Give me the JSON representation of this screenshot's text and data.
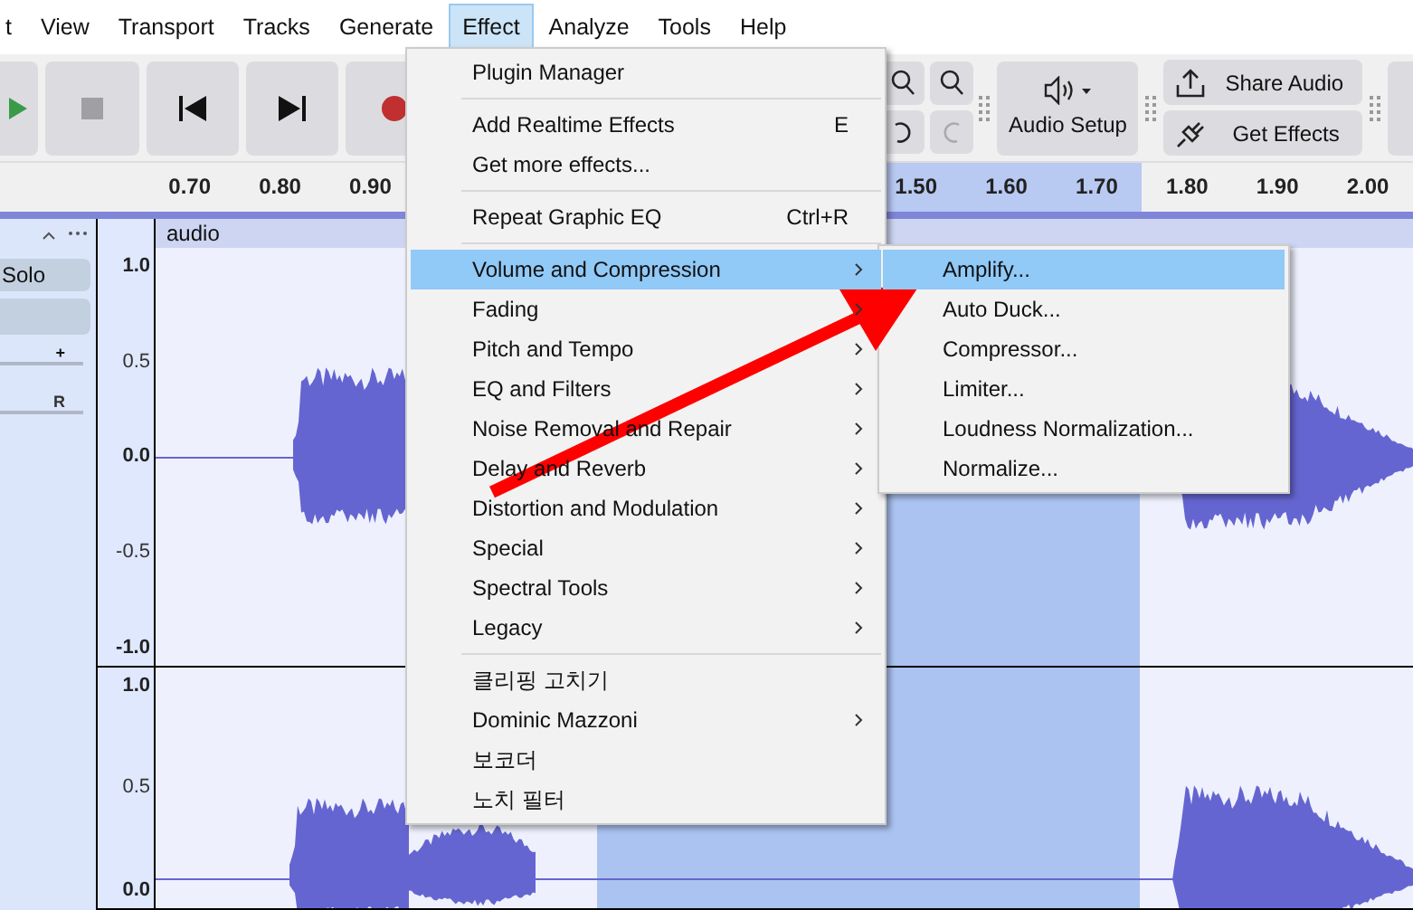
{
  "menubar": [
    {
      "label": "t",
      "selected": false
    },
    {
      "label": "View",
      "selected": false
    },
    {
      "label": "Transport",
      "selected": false
    },
    {
      "label": "Tracks",
      "selected": false
    },
    {
      "label": "Generate",
      "selected": false
    },
    {
      "label": "Effect",
      "selected": true
    },
    {
      "label": "Analyze",
      "selected": false
    },
    {
      "label": "Tools",
      "selected": false
    },
    {
      "label": "Help",
      "selected": false
    }
  ],
  "toolbar": {
    "audio_setup": "Audio Setup",
    "share_audio": "Share Audio",
    "get_effects": "Get Effects"
  },
  "ruler": {
    "left_labels": [
      "0.70",
      "0.80",
      "0.90"
    ],
    "right_labels": [
      "1.50",
      "1.60",
      "1.70",
      "1.80",
      "1.90",
      "2.00"
    ]
  },
  "track": {
    "name": "audio",
    "solo": "Solo",
    "gain_mark": "+",
    "pan_mark": "R",
    "channel_1_scale": [
      "1.0",
      "0.5",
      "0.0",
      "-0.5",
      "-1.0"
    ],
    "channel_2_scale": [
      "1.0",
      "0.5",
      "0.0"
    ]
  },
  "effect_menu": [
    {
      "kind": "item",
      "label": "Plugin Manager",
      "submenu": false,
      "selected": false
    },
    {
      "kind": "separator"
    },
    {
      "kind": "item",
      "label": "Add Realtime Effects",
      "shortcut": "E",
      "submenu": false,
      "selected": false
    },
    {
      "kind": "item",
      "label": "Get more effects...",
      "submenu": false,
      "selected": false
    },
    {
      "kind": "separator"
    },
    {
      "kind": "item",
      "label": "Repeat Graphic EQ",
      "shortcut": "Ctrl+R",
      "submenu": false,
      "selected": false
    },
    {
      "kind": "separator"
    },
    {
      "kind": "item",
      "label": "Volume and Compression",
      "submenu": true,
      "selected": true
    },
    {
      "kind": "item",
      "label": "Fading",
      "submenu": true,
      "selected": false
    },
    {
      "kind": "item",
      "label": "Pitch and Tempo",
      "submenu": true,
      "selected": false
    },
    {
      "kind": "item",
      "label": "EQ and Filters",
      "submenu": true,
      "selected": false
    },
    {
      "kind": "item",
      "label": "Noise Removal and Repair",
      "submenu": true,
      "selected": false
    },
    {
      "kind": "item",
      "label": "Delay and Reverb",
      "submenu": true,
      "selected": false
    },
    {
      "kind": "item",
      "label": "Distortion and Modulation",
      "submenu": true,
      "selected": false
    },
    {
      "kind": "item",
      "label": "Special",
      "submenu": true,
      "selected": false
    },
    {
      "kind": "item",
      "label": "Spectral Tools",
      "submenu": true,
      "selected": false
    },
    {
      "kind": "item",
      "label": "Legacy",
      "submenu": true,
      "selected": false
    },
    {
      "kind": "separator"
    },
    {
      "kind": "item",
      "label": "클리핑 고치기",
      "submenu": false,
      "selected": false
    },
    {
      "kind": "item",
      "label": "Dominic Mazzoni",
      "submenu": true,
      "selected": false
    },
    {
      "kind": "item",
      "label": "보코더",
      "submenu": false,
      "selected": false
    },
    {
      "kind": "item",
      "label": "노치 필터",
      "submenu": false,
      "selected": false
    }
  ],
  "volume_submenu": [
    {
      "label": "Amplify...",
      "selected": true
    },
    {
      "label": "Auto Duck...",
      "selected": false
    },
    {
      "label": "Compressor...",
      "selected": false
    },
    {
      "label": "Limiter...",
      "selected": false
    },
    {
      "label": "Loudness Normalization...",
      "selected": false
    },
    {
      "label": "Normalize...",
      "selected": false
    }
  ]
}
